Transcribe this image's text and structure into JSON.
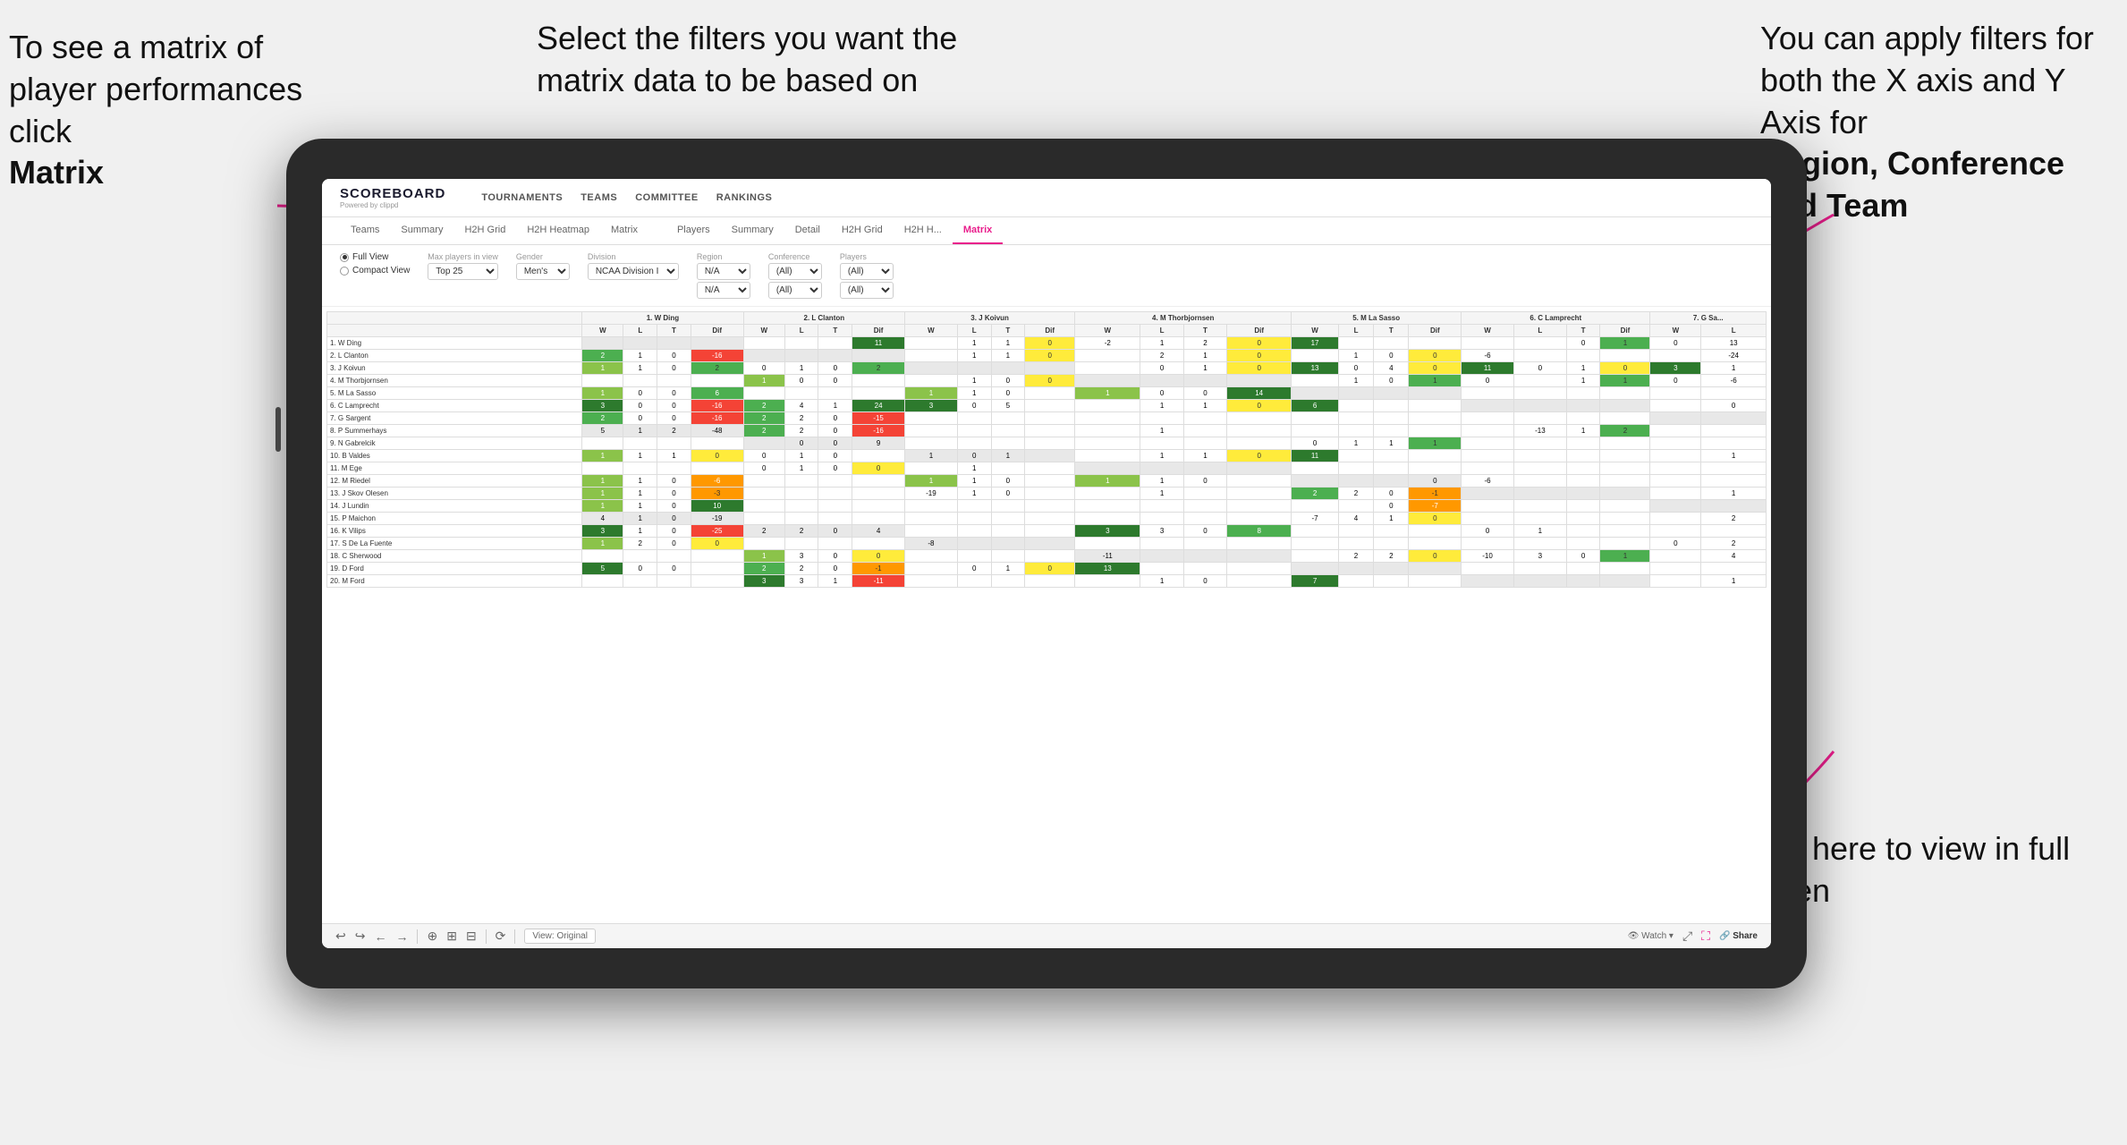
{
  "annotations": {
    "matrix_label": "To see a matrix of player performances click",
    "matrix_bold": "Matrix",
    "filters_label": "Select the filters you want the matrix data to be based on",
    "axes_label": "You  can apply filters for both the X axis and Y Axis for",
    "axes_bold": "Region, Conference and Team",
    "fullscreen_label": "Click here to view in full screen"
  },
  "app": {
    "title": "SCOREBOARD",
    "powered_by": "Powered by clippd"
  },
  "top_nav": {
    "items": [
      "TOURNAMENTS",
      "TEAMS",
      "COMMITTEE",
      "RANKINGS"
    ]
  },
  "sub_nav": {
    "teams_tabs": [
      "Teams",
      "Summary",
      "H2H Grid",
      "H2H Heatmap",
      "Matrix"
    ],
    "players_tabs": [
      "Players",
      "Summary",
      "Detail",
      "H2H Grid",
      "H2H H...",
      "Matrix"
    ]
  },
  "active_tab": "Matrix",
  "filters": {
    "view": {
      "full": "Full View",
      "compact": "Compact View",
      "selected": "Full View"
    },
    "max_players": {
      "label": "Max players in view",
      "value": "Top 25"
    },
    "gender": {
      "label": "Gender",
      "value": "Men's"
    },
    "division": {
      "label": "Division",
      "value": "NCAA Division I"
    },
    "region": {
      "label": "Region",
      "value1": "N/A",
      "value2": "N/A"
    },
    "conference": {
      "label": "Conference",
      "value1": "(All)",
      "value2": "(All)"
    },
    "players": {
      "label": "Players",
      "value1": "(All)",
      "value2": "(All)"
    }
  },
  "players": [
    "1. W Ding",
    "2. L Clanton",
    "3. J Koivun",
    "4. M Thorbjornsen",
    "5. M La Sasso",
    "6. C Lamprecht",
    "7. G Sargent",
    "8. P Summerhays",
    "9. N Gabrelcik",
    "10. B Valdes",
    "11. M Ege",
    "12. M Riedel",
    "13. J Skov Olesen",
    "14. J Lundin",
    "15. P Maichon",
    "16. K Vilips",
    "17. S De La Fuente",
    "18. C Sherwood",
    "19. D Ford",
    "20. M Ford"
  ],
  "col_headers": [
    "1. W Ding",
    "2. L Clanton",
    "3. J Koivun",
    "4. M Thorbjornsen",
    "5. M La Sasso",
    "6. C Lamprecht",
    "7. G Sa..."
  ],
  "toolbar": {
    "view_original": "View: Original",
    "watch": "Watch",
    "share": "Share"
  }
}
